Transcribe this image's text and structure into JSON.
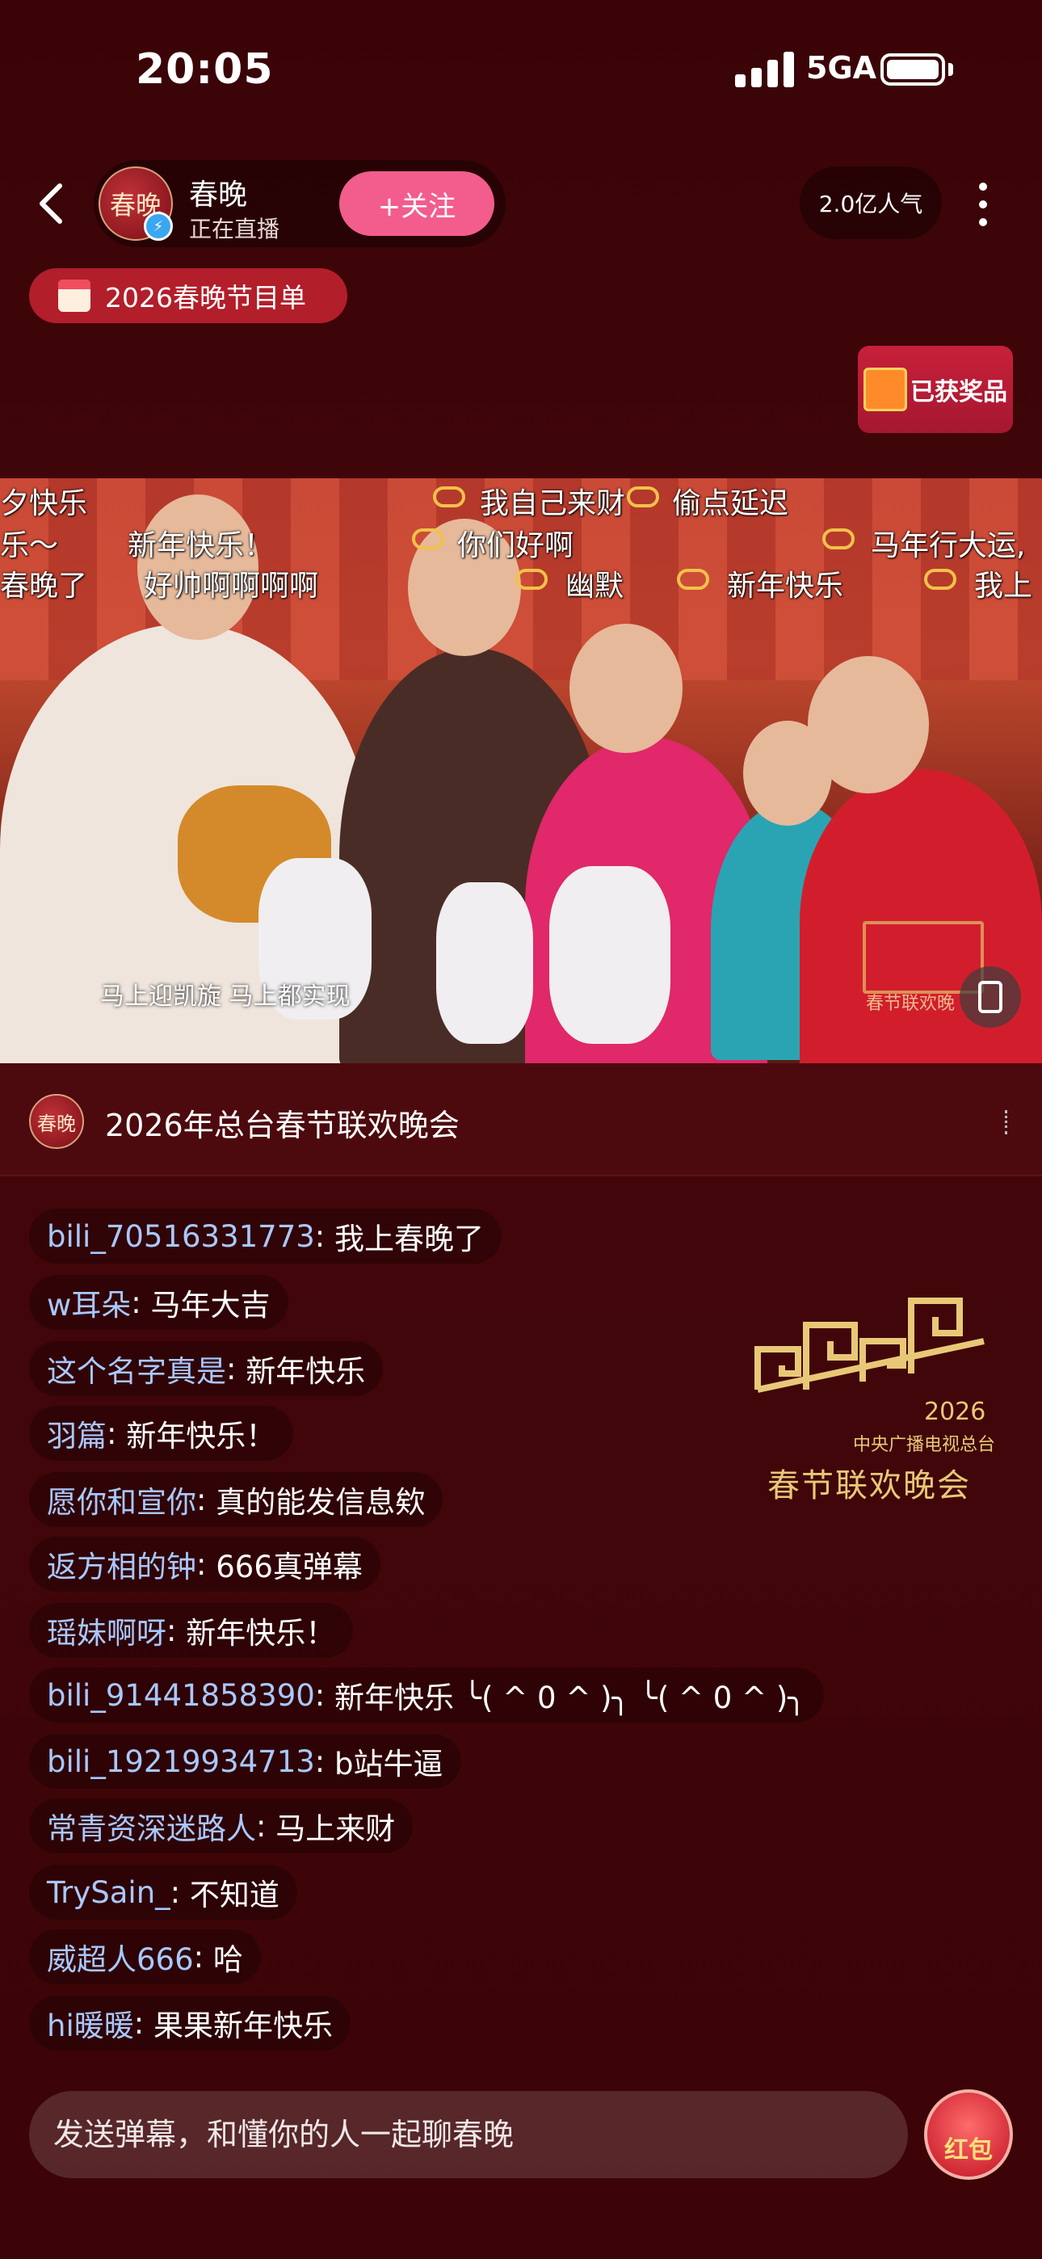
{
  "status_bar": {
    "time": "20:05",
    "network": "5GA"
  },
  "header": {
    "anchor_avatar": "春晚",
    "anchor_name": "春晚",
    "anchor_status": "正在直播",
    "follow_label": "+关注",
    "popularity": "2.0亿人气"
  },
  "program_button": "2026春晚节目单",
  "prize_button": "已获奖品",
  "video": {
    "danmaku": [
      "夕快乐",
      "乐～",
      "新年快乐！",
      "春晚了",
      "好帅啊啊啊啊",
      "我自己来财",
      "偷点延迟",
      "你们好啊",
      "幽默",
      "新年快乐",
      "马年行大运,",
      "我上"
    ],
    "subtitle": "马上迎凯旋 马上都实现",
    "watermark": "春节联欢晚"
  },
  "show": {
    "avatar": "春晚",
    "title": "2026年总台春节联欢晚会"
  },
  "chat": [
    {
      "user": "bili_70516331773",
      "text": "我上春晚了"
    },
    {
      "user": "w耳朵",
      "text": "马年大吉"
    },
    {
      "user": "这个名字真是",
      "text": "新年快乐"
    },
    {
      "user": "羽篇",
      "text": "新年快乐！"
    },
    {
      "user": "愿你和宣你",
      "text": "真的能发信息欸"
    },
    {
      "user": "返方相的钟",
      "text": "666真弹幕"
    },
    {
      "user": "瑶妹啊呀",
      "text": "新年快乐！"
    },
    {
      "user": "bili_91441858390",
      "text": "新年快乐 ╰( ^ 0 ^ )╮ ╰( ^ 0 ^ )╮"
    },
    {
      "user": "bili_19219934713",
      "text": "b站牛逼"
    },
    {
      "user": "常青资深迷路人",
      "text": "马上来财"
    },
    {
      "user": "TrySain_",
      "text": "不知道"
    },
    {
      "user": "威超人666",
      "text": "哈"
    },
    {
      "user": "hi暖暖",
      "text": "果果新年快乐"
    }
  ],
  "gala_logo": {
    "year": "2026",
    "org": "中央广播电视总台",
    "name": "春节联欢晚会"
  },
  "input": {
    "placeholder": "发送弹幕，和懂你的人一起聊春晚"
  },
  "redpacket_label": "红包",
  "colors": {
    "accent_pink": "#f25d8e",
    "username_blue": "#a9c8ff",
    "bg": "#3d0508",
    "gold": "#e8c877"
  }
}
